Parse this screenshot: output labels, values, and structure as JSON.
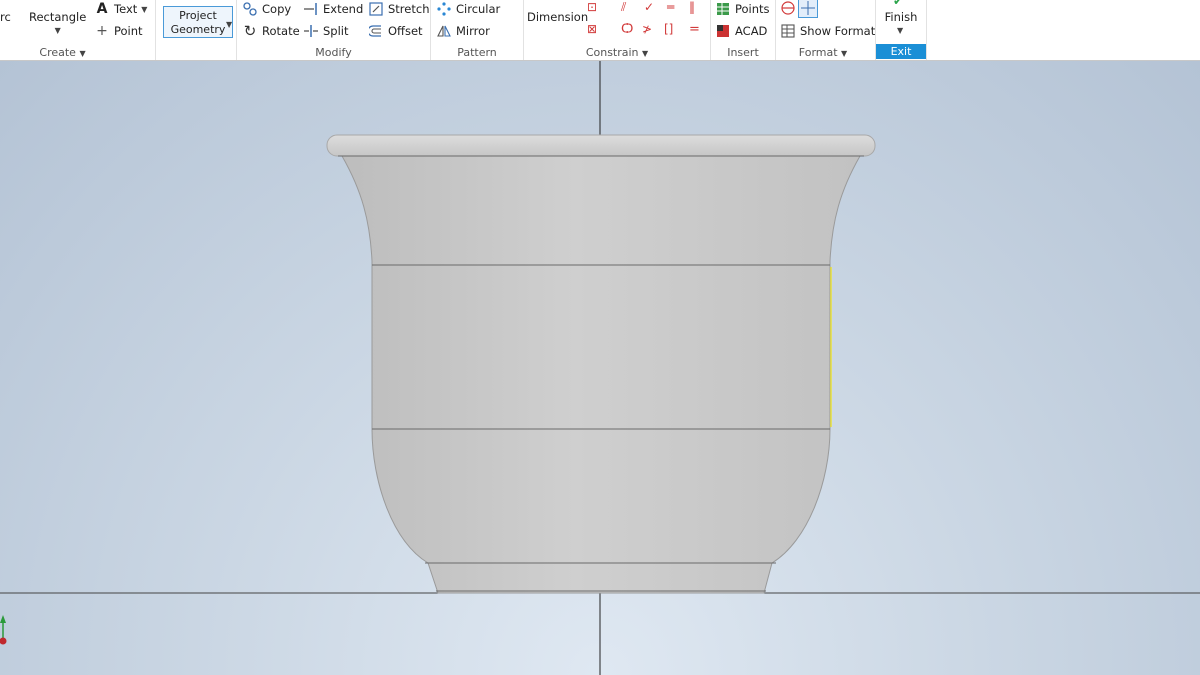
{
  "ribbon": {
    "create": {
      "arc_label": "rc",
      "rectangle_label": "Rectangle",
      "text_label": "Text",
      "point_label": "Point",
      "panel_label": "Create"
    },
    "project_geometry": {
      "line1": "Project",
      "line2": "Geometry"
    },
    "modify": {
      "copy_label": "Copy",
      "rotate_label": "Rotate",
      "extend_label": "Extend",
      "split_label": "Split",
      "stretch_label": "Stretch",
      "offset_label": "Offset",
      "panel_label": "Modify"
    },
    "pattern": {
      "circular_label": "Circular",
      "mirror_label": "Mirror",
      "panel_label": "Pattern"
    },
    "constrain": {
      "dimension_label": "Dimension",
      "panel_label": "Constrain"
    },
    "insert": {
      "points_label": "Points",
      "acad_label": "ACAD",
      "panel_label": "Insert"
    },
    "format": {
      "show_format_label": "Show Format",
      "panel_label": "Format"
    },
    "exit": {
      "finish_label": "Finish",
      "panel_label": "Exit"
    }
  },
  "colors": {
    "accent": "#1b8fd6",
    "constraint_red": "#d23a3a",
    "model_gray": "#c4c4c4",
    "highlight_yellow": "#e9e23a"
  }
}
